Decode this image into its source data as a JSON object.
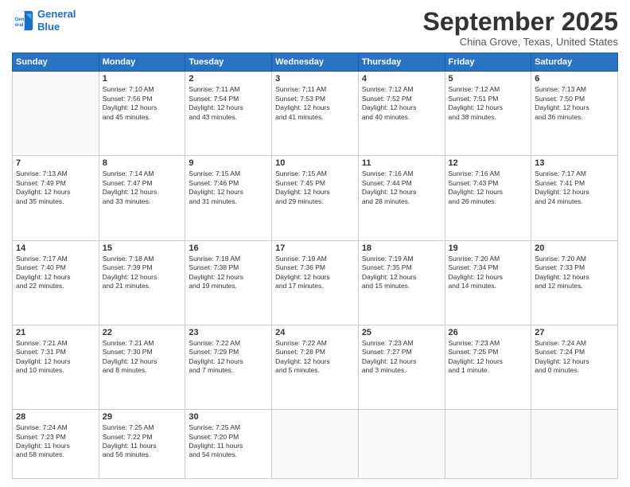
{
  "logo": {
    "line1": "General",
    "line2": "Blue"
  },
  "title": "September 2025",
  "location": "China Grove, Texas, United States",
  "days_header": [
    "Sunday",
    "Monday",
    "Tuesday",
    "Wednesday",
    "Thursday",
    "Friday",
    "Saturday"
  ],
  "weeks": [
    [
      {
        "num": "",
        "info": ""
      },
      {
        "num": "1",
        "info": "Sunrise: 7:10 AM\nSunset: 7:56 PM\nDaylight: 12 hours\nand 45 minutes."
      },
      {
        "num": "2",
        "info": "Sunrise: 7:11 AM\nSunset: 7:54 PM\nDaylight: 12 hours\nand 43 minutes."
      },
      {
        "num": "3",
        "info": "Sunrise: 7:11 AM\nSunset: 7:53 PM\nDaylight: 12 hours\nand 41 minutes."
      },
      {
        "num": "4",
        "info": "Sunrise: 7:12 AM\nSunset: 7:52 PM\nDaylight: 12 hours\nand 40 minutes."
      },
      {
        "num": "5",
        "info": "Sunrise: 7:12 AM\nSunset: 7:51 PM\nDaylight: 12 hours\nand 38 minutes."
      },
      {
        "num": "6",
        "info": "Sunrise: 7:13 AM\nSunset: 7:50 PM\nDaylight: 12 hours\nand 36 minutes."
      }
    ],
    [
      {
        "num": "7",
        "info": "Sunrise: 7:13 AM\nSunset: 7:49 PM\nDaylight: 12 hours\nand 35 minutes."
      },
      {
        "num": "8",
        "info": "Sunrise: 7:14 AM\nSunset: 7:47 PM\nDaylight: 12 hours\nand 33 minutes."
      },
      {
        "num": "9",
        "info": "Sunrise: 7:15 AM\nSunset: 7:46 PM\nDaylight: 12 hours\nand 31 minutes."
      },
      {
        "num": "10",
        "info": "Sunrise: 7:15 AM\nSunset: 7:45 PM\nDaylight: 12 hours\nand 29 minutes."
      },
      {
        "num": "11",
        "info": "Sunrise: 7:16 AM\nSunset: 7:44 PM\nDaylight: 12 hours\nand 28 minutes."
      },
      {
        "num": "12",
        "info": "Sunrise: 7:16 AM\nSunset: 7:43 PM\nDaylight: 12 hours\nand 26 minutes."
      },
      {
        "num": "13",
        "info": "Sunrise: 7:17 AM\nSunset: 7:41 PM\nDaylight: 12 hours\nand 24 minutes."
      }
    ],
    [
      {
        "num": "14",
        "info": "Sunrise: 7:17 AM\nSunset: 7:40 PM\nDaylight: 12 hours\nand 22 minutes."
      },
      {
        "num": "15",
        "info": "Sunrise: 7:18 AM\nSunset: 7:39 PM\nDaylight: 12 hours\nand 21 minutes."
      },
      {
        "num": "16",
        "info": "Sunrise: 7:18 AM\nSunset: 7:38 PM\nDaylight: 12 hours\nand 19 minutes."
      },
      {
        "num": "17",
        "info": "Sunrise: 7:19 AM\nSunset: 7:36 PM\nDaylight: 12 hours\nand 17 minutes."
      },
      {
        "num": "18",
        "info": "Sunrise: 7:19 AM\nSunset: 7:35 PM\nDaylight: 12 hours\nand 15 minutes."
      },
      {
        "num": "19",
        "info": "Sunrise: 7:20 AM\nSunset: 7:34 PM\nDaylight: 12 hours\nand 14 minutes."
      },
      {
        "num": "20",
        "info": "Sunrise: 7:20 AM\nSunset: 7:33 PM\nDaylight: 12 hours\nand 12 minutes."
      }
    ],
    [
      {
        "num": "21",
        "info": "Sunrise: 7:21 AM\nSunset: 7:31 PM\nDaylight: 12 hours\nand 10 minutes."
      },
      {
        "num": "22",
        "info": "Sunrise: 7:21 AM\nSunset: 7:30 PM\nDaylight: 12 hours\nand 8 minutes."
      },
      {
        "num": "23",
        "info": "Sunrise: 7:22 AM\nSunset: 7:29 PM\nDaylight: 12 hours\nand 7 minutes."
      },
      {
        "num": "24",
        "info": "Sunrise: 7:22 AM\nSunset: 7:28 PM\nDaylight: 12 hours\nand 5 minutes."
      },
      {
        "num": "25",
        "info": "Sunrise: 7:23 AM\nSunset: 7:27 PM\nDaylight: 12 hours\nand 3 minutes."
      },
      {
        "num": "26",
        "info": "Sunrise: 7:23 AM\nSunset: 7:25 PM\nDaylight: 12 hours\nand 1 minute."
      },
      {
        "num": "27",
        "info": "Sunrise: 7:24 AM\nSunset: 7:24 PM\nDaylight: 12 hours\nand 0 minutes."
      }
    ],
    [
      {
        "num": "28",
        "info": "Sunrise: 7:24 AM\nSunset: 7:23 PM\nDaylight: 11 hours\nand 58 minutes."
      },
      {
        "num": "29",
        "info": "Sunrise: 7:25 AM\nSunset: 7:22 PM\nDaylight: 11 hours\nand 56 minutes."
      },
      {
        "num": "30",
        "info": "Sunrise: 7:25 AM\nSunset: 7:20 PM\nDaylight: 11 hours\nand 54 minutes."
      },
      {
        "num": "",
        "info": ""
      },
      {
        "num": "",
        "info": ""
      },
      {
        "num": "",
        "info": ""
      },
      {
        "num": "",
        "info": ""
      }
    ]
  ]
}
